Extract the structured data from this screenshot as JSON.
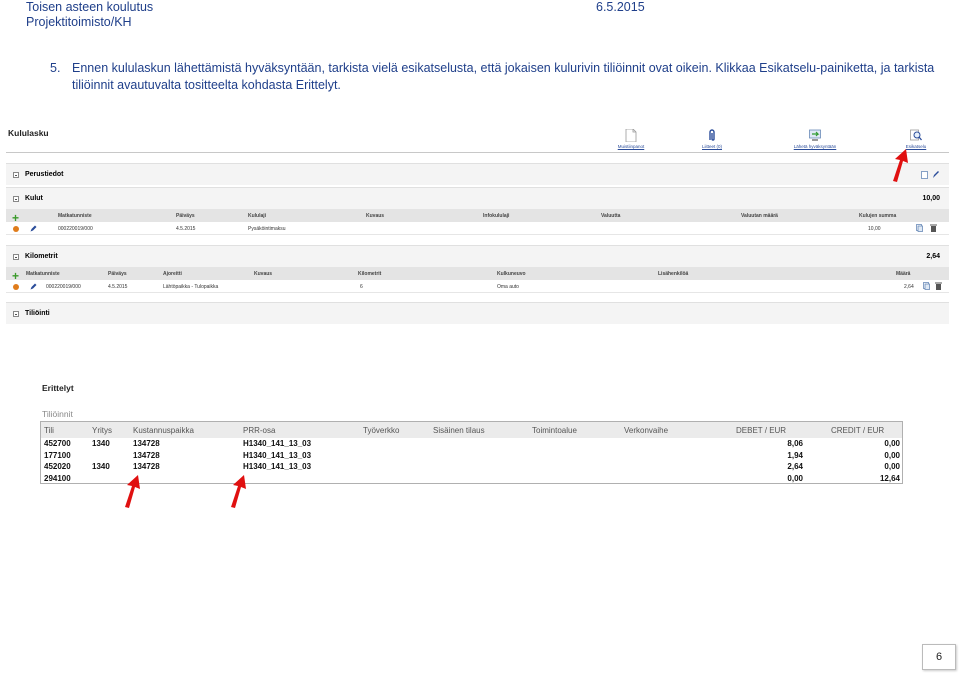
{
  "header": {
    "title": "Toisen asteen koulutus",
    "subtitle": "Projektitoimisto/KH",
    "date": "6.5.2015"
  },
  "instruction": {
    "number": "5.",
    "text": "Ennen kululaskun lähettämistä hyväksyntään, tarkista vielä esikatselusta, että jokaisen kulurivin tiliöinnit ovat oikein. Klikkaa Esikatselu-painiketta, ja tarkista tiliöinnit avautuvalta tositteelta kohdasta Erittelyt."
  },
  "kululasku": {
    "title": "Kululasku",
    "toolbar": [
      {
        "label": "Muistiinpanot",
        "icon": "note-icon"
      },
      {
        "label": "Liitteet (0)",
        "icon": "paperclip-icon"
      },
      {
        "label": "Lähetä hyväksyntään",
        "icon": "send-icon"
      },
      {
        "label": "Esikatselu",
        "icon": "preview-icon"
      }
    ],
    "perustiedot": {
      "label": "Perustiedot"
    },
    "kulut": {
      "label": "Kulut",
      "total": "10,00",
      "columns": [
        "Matkatunniste",
        "Päiväys",
        "Kululaji",
        "Kuvaus",
        "Infokululaji",
        "Valuutta",
        "Valuutan määrä",
        "Kulujen summa"
      ],
      "row": {
        "matkatunniste": "000220019/000",
        "paivays": "4.5.2015",
        "kululaji": "Pysäköintimaksu",
        "summa": "10,00"
      }
    },
    "kilometrit": {
      "label": "Kilometrit",
      "total": "2,64",
      "columns": [
        "Matkatunniste",
        "Päiväys",
        "Ajoreitti",
        "Kuvaus",
        "Kilometrit",
        "Kulkuneuvo",
        "Lisähenkilöä",
        "Määrä"
      ],
      "row": {
        "matkatunniste": "000220019/000",
        "paivays": "4.5.2015",
        "ajoreitti": "Lähtöpaikka - Tulopaikka",
        "kilometrit": "6",
        "kulkuneuvo": "Oma auto",
        "maara": "2,64"
      }
    },
    "tilioinnit": {
      "label": "Tiliöinti"
    }
  },
  "erittelyt": {
    "title": "Erittelyt",
    "subtitle": "Tiliöinnit",
    "columns": [
      "Tili",
      "Yritys",
      "Kustannuspaikka",
      "PRR-osa",
      "Työverkko",
      "Sisäinen tilaus",
      "Toimintoalue",
      "Verkonvaihe",
      "DEBET / EUR",
      "CREDIT / EUR"
    ],
    "rows": [
      {
        "tili": "452700",
        "yritys": "1340",
        "kp": "134728",
        "prr": "H1340_141_13_03",
        "debet": "8,06",
        "credit": "0,00"
      },
      {
        "tili": "177100",
        "yritys": "",
        "kp": "134728",
        "prr": "H1340_141_13_03",
        "debet": "1,94",
        "credit": "0,00"
      },
      {
        "tili": "452020",
        "yritys": "1340",
        "kp": "134728",
        "prr": "H1340_141_13_03",
        "debet": "2,64",
        "credit": "0,00"
      },
      {
        "tili": "294100",
        "yritys": "",
        "kp": "",
        "prr": "",
        "debet": "0,00",
        "credit": "12,64"
      }
    ]
  },
  "page_number": "6",
  "colors": {
    "header_text": "#1f3f8a",
    "arrow": "#e01010",
    "link": "#2a4c9a"
  }
}
